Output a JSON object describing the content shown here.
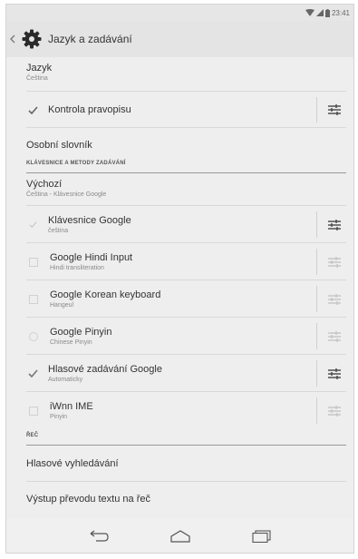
{
  "status_bar": {
    "time": "23:41"
  },
  "action_bar": {
    "title": "Jazyk a zadávání"
  },
  "language": {
    "title": "Jazyk",
    "value": "Čeština"
  },
  "spellcheck": {
    "label": "Kontrola pravopisu",
    "checked": true
  },
  "dictionary": {
    "label": "Osobní slovník"
  },
  "keyboards_section": {
    "title": "KLÁVESNICE A METODY ZADÁVÁNÍ"
  },
  "default_input": {
    "title": "Výchozí",
    "value": "Čeština - Klávesnice Google"
  },
  "keyboards": [
    {
      "name": "Klávesnice Google",
      "sub": "čeština",
      "checked": true,
      "dimmed": true
    },
    {
      "name": "Google Hindi Input",
      "sub": "Hindi transliteration",
      "checked": false
    },
    {
      "name": "Google Korean keyboard",
      "sub": "Hangeul",
      "checked": false
    },
    {
      "name": "Google Pinyin",
      "sub": "Chinese Pinyin",
      "checked": false
    },
    {
      "name": "Hlasové zadávání Google",
      "sub": "Automaticky",
      "checked": true
    },
    {
      "name": "iWnn IME",
      "sub": "Pinyin",
      "checked": false
    }
  ],
  "speech_section": {
    "title": "ŘEČ"
  },
  "voice_search": {
    "label": "Hlasové vyhledávání"
  },
  "tts": {
    "label": "Výstup převodu textu na řeč"
  }
}
